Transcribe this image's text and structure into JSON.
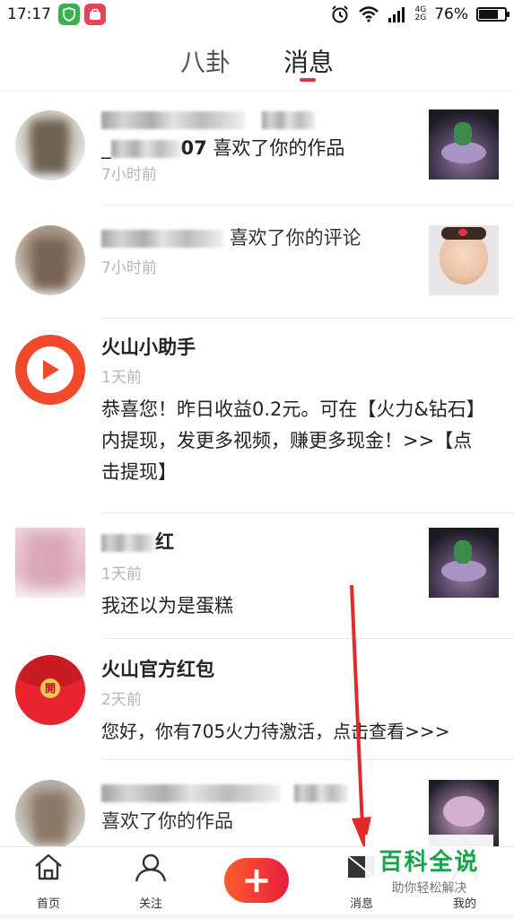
{
  "statusbar": {
    "time": "17:17",
    "battery": "76%",
    "battery_level": 0.76,
    "net_top": "4G",
    "net_bottom": "2G"
  },
  "tabs": [
    {
      "label": "八卦"
    },
    {
      "label": "消息"
    }
  ],
  "messages": [
    {
      "line1": "喜欢了你的作品",
      "line1_prefix": "_",
      "line1_suffix": "07",
      "time": "7小时前",
      "thumb": "cake"
    },
    {
      "line1": "喜欢了你的评论",
      "time": "7小时前",
      "thumb": "baby"
    },
    {
      "name": "火山小助手",
      "time": "1天前",
      "msg": "恭喜您！昨日收益0.2元。可在【火力&钻石】内提现，发更多视频，赚更多现金！>>【点击提现】"
    },
    {
      "name_suffix": "红",
      "time": "1天前",
      "msg": "我还以为是蛋糕",
      "thumb": "cake"
    },
    {
      "name": "火山官方红包",
      "time": "2天前",
      "msg": "您好，你有705火力待激活，点击查看>>>",
      "envelope_label": "開"
    },
    {
      "line1": "喜欢了你的作品",
      "time": "",
      "thumb": "cake2"
    }
  ],
  "bottom_nav": {
    "home": "首页",
    "follow": "关注",
    "plus": "+",
    "messages": "消息",
    "me": "我的"
  },
  "watermark": {
    "title": "百科全说",
    "subtitle": "助你轻松解决"
  }
}
